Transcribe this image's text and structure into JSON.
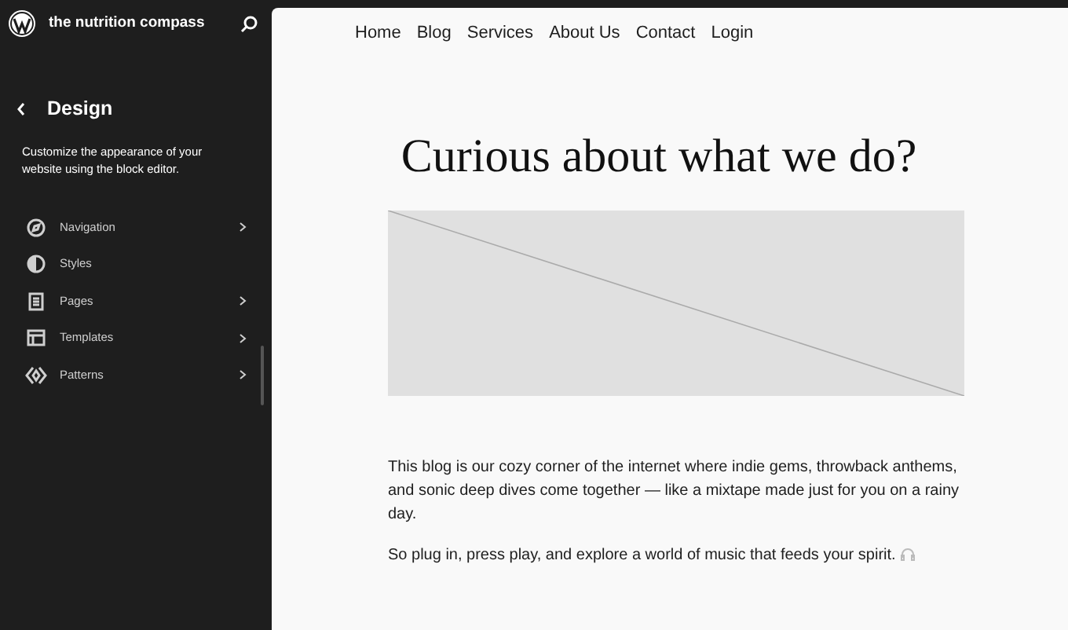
{
  "site_title": "the nutrition compass",
  "panel": {
    "title": "Design",
    "description": "Customize the appearance of your website using the block editor."
  },
  "menu": [
    {
      "label": "Navigation",
      "has_submenu": true
    },
    {
      "label": "Styles",
      "has_submenu": false
    },
    {
      "label": "Pages",
      "has_submenu": true
    },
    {
      "label": "Templates",
      "has_submenu": true
    },
    {
      "label": "Patterns",
      "has_submenu": true
    }
  ],
  "site_nav": [
    "Home",
    "Blog",
    "Services",
    "About Us",
    "Contact",
    "Login"
  ],
  "heading": "Curious about what we do?",
  "paragraphs": [
    "This blog is our cozy corner of the internet where indie gems, throwback anthems, and sonic deep dives come together — like a mixtape made just for you on a rainy day.",
    "So plug in, press play, and explore a world of music that feeds your spirit."
  ]
}
